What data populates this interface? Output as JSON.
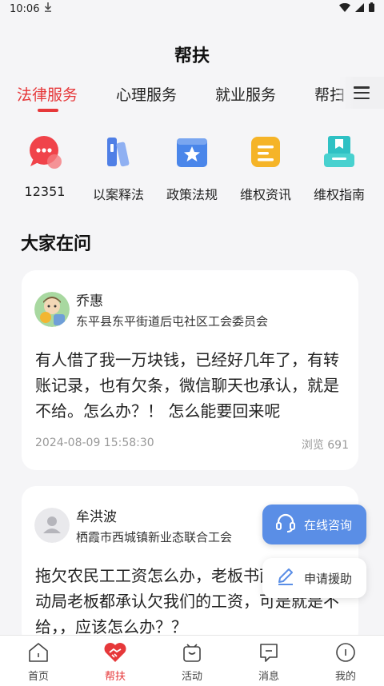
{
  "status_bar": {
    "time": "10:06"
  },
  "header": {
    "title": "帮扶"
  },
  "tabs": [
    {
      "label": "法律服务",
      "active": true
    },
    {
      "label": "心理服务",
      "active": false
    },
    {
      "label": "就业服务",
      "active": false
    },
    {
      "label": "帮扫",
      "active": false
    }
  ],
  "services": [
    {
      "label": "12351",
      "icon": "chat-bubble-icon",
      "color": "#f0434a"
    },
    {
      "label": "以案释法",
      "icon": "books-icon",
      "color": "#4f7fe6"
    },
    {
      "label": "政策法规",
      "icon": "star-card-icon",
      "color": "#4a86ea"
    },
    {
      "label": "维权资讯",
      "icon": "document-icon",
      "color": "#f5b428"
    },
    {
      "label": "维权指南",
      "icon": "guide-book-icon",
      "color": "#2fc1c4"
    }
  ],
  "section_title": "大家在问",
  "questions": [
    {
      "name": "乔惠",
      "org": "东平县东平街道后屯社区工会委员会",
      "text": "有人借了我一万块钱，已经好几年了，有转账记录，也有欠条，微信聊天也承认，就是不给。怎么办？！ 怎么能要回来呢",
      "date": "2024-08-09 15:58:30",
      "views": "浏览  691"
    },
    {
      "name": "牟洪波",
      "org": "栖霞市西城镇新业态联合工会",
      "text": "拖欠农民工工资怎么办，老板书面承诺，劳动局老板都承认欠我们的工资，可是就是不给，，应该怎么办？？"
    }
  ],
  "fab": {
    "consult": "在线咨询",
    "apply": "申请援助"
  },
  "bottom_nav": [
    {
      "label": "首页",
      "active": false
    },
    {
      "label": "帮扶",
      "active": true
    },
    {
      "label": "活动",
      "active": false
    },
    {
      "label": "消息",
      "active": false
    },
    {
      "label": "我的",
      "active": false
    }
  ],
  "colors": {
    "accent": "#e6383a",
    "consult_button": "#5a8ee6"
  }
}
